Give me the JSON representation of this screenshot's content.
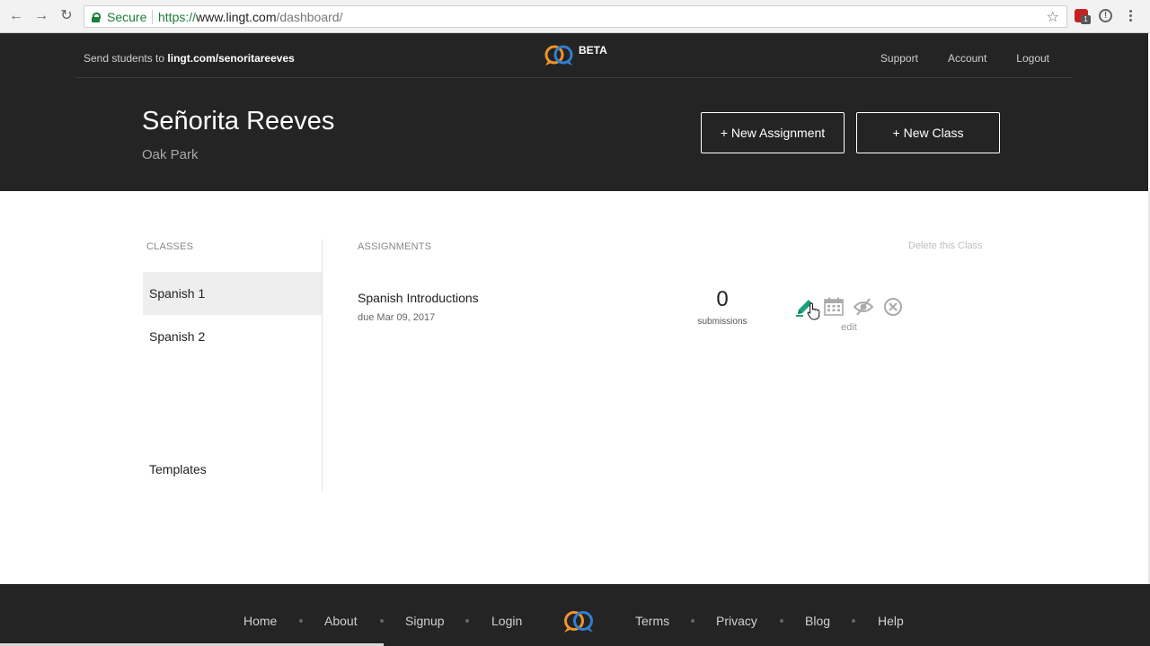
{
  "browser": {
    "secure_label": "Secure",
    "url_proto": "https://",
    "url_host": "www.lingt.com",
    "url_path": "/dashboard/",
    "extension_badge": "1"
  },
  "header": {
    "send_prefix": "Send students to ",
    "send_link": "lingt.com/senoritareeves",
    "beta": "BETA",
    "links": [
      "Support",
      "Account",
      "Logout"
    ],
    "teacher_name": "Señorita Reeves",
    "school": "Oak Park",
    "new_assignment": "+ New Assignment",
    "new_class": "+ New Class"
  },
  "classes": {
    "label": "CLASSES",
    "items": [
      "Spanish 1",
      "Spanish 2"
    ],
    "templates": "Templates"
  },
  "assignments": {
    "label": "ASSIGNMENTS",
    "delete_class": "Delete this Class",
    "items": [
      {
        "title": "Spanish Introductions",
        "due": "due Mar 09, 2017",
        "submissions_count": "0",
        "submissions_label": "submissions",
        "hover_label": "edit"
      }
    ]
  },
  "footer": {
    "links_left": [
      "Home",
      "About",
      "Signup",
      "Login"
    ],
    "links_right": [
      "Terms",
      "Privacy",
      "Blog",
      "Help"
    ]
  },
  "colors": {
    "header_bg": "#242424",
    "edit_accent": "#1aa37a",
    "logo_orange": "#f0932b",
    "logo_blue": "#2f7fd0",
    "secure_green": "#188038"
  }
}
